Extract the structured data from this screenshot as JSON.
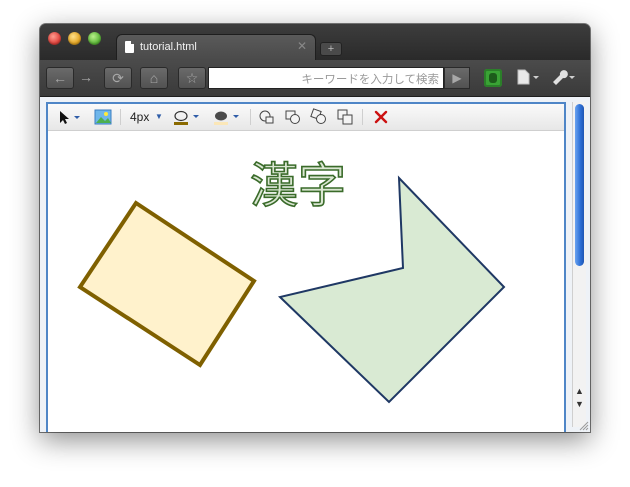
{
  "browser": {
    "tab_title": "tutorial.html",
    "tab_close": "✕",
    "new_tab": "+",
    "address_placeholder": "キーワードを入力して検索",
    "nav": {
      "back_icon": "arrow-left-icon",
      "forward_icon": "arrow-right-icon",
      "reload_icon": "reload-icon",
      "home_icon": "home-icon",
      "star_icon": "star-icon",
      "go_icon": "play-icon"
    },
    "menus": {
      "extension_icon": "evernote-icon",
      "page_menu_icon": "page-icon",
      "wrench_menu_icon": "wrench-icon"
    }
  },
  "editor": {
    "toolbar": {
      "select_tool_icon": "arrow-cursor-icon",
      "image_tool_icon": "image-icon",
      "stroke_width_label": "4px",
      "stroke_color": "#8a6a00",
      "fill_color": "#4a4a4a",
      "delete_icon": "x-icon",
      "delete_color": "#cc1111"
    },
    "canvas": {
      "text_label": "漢字",
      "text_fill": "#dbe7d3",
      "text_stroke": "#3a6b2a",
      "rect_fill": "#fff2cc",
      "rect_stroke": "#7f6000",
      "polygon_fill": "#d9ead3",
      "polygon_stroke": "#1f3864"
    }
  }
}
